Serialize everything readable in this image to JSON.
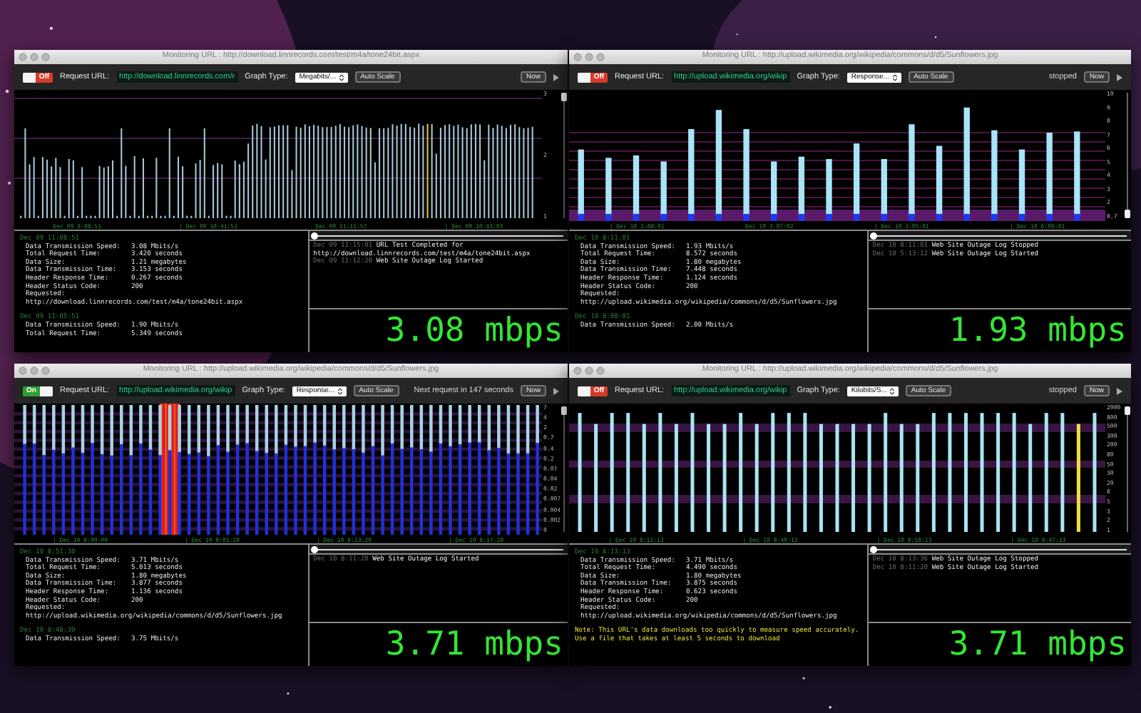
{
  "windows": [
    {
      "title": "Monitoring URL : http://download.linnrecords.com/test/m4a/tone24bit.aspx",
      "toggle": {
        "label": "Off",
        "on": false
      },
      "url_label": "Request URL:",
      "url": "http://download.linnrecords.com/r",
      "graph_type_label": "Graph Type:",
      "graph_type": "Megabits/...",
      "auto_scale": "Auto Scale",
      "now": "Now",
      "graph": {
        "kind": "thin",
        "y_labels": [
          "3",
          "2",
          "1"
        ],
        "time_labels": [
          "Dec 09 8:08:51",
          "| Dec 09 10:41:51",
          "Dec 09 11:15:57",
          "| Dec 09 10:43:03"
        ]
      },
      "timeline": {
        "level": 0
      },
      "results": [
        {
          "time": "Dec 09 11:08:51",
          "fields": [
            {
              "label": "Data Transmission Speed:",
              "value": "3.08 Mbits/s"
            },
            {
              "label": "Total Request Time:",
              "value": "3.420 seconds"
            },
            {
              "label": "Data Size:",
              "value": "1.21 megabytes"
            },
            {
              "label": "Data Transmission Time:",
              "value": "3.153 seconds"
            },
            {
              "label": "Header Response Time:",
              "value": "0.267 seconds"
            },
            {
              "label": "Header Status Code:",
              "value": "200"
            }
          ],
          "requested_label": "Requested:",
          "requested": "http://download.linnrecords.com/test/m4a/tone24bit.aspx"
        },
        {
          "time": "Dec 09 11:05:51",
          "fields": [
            {
              "label": "Data Transmission Speed:",
              "value": "1.90 Mbits/s"
            },
            {
              "label": "Total Request Time:",
              "value": "5.349 seconds"
            }
          ]
        }
      ],
      "events": [
        {
          "time": "Dec 09 11:15:01",
          "text": "URL Test Completed for http://download.linnrecords.com/test/m4a/tone24bit.aspx"
        },
        {
          "time": "Dec 09 11:12:20",
          "text": "Web Site Outage Log Started"
        }
      ],
      "speed": "3.08 mbps"
    },
    {
      "title": "Monitoring URL : http://upload.wikimedia.org/wikipedia/commons/d/d5/Sunflowers.jpg",
      "toggle": {
        "label": "Off",
        "on": false
      },
      "url_label": "Request URL:",
      "url": "http://upload.wikimedia.org/wikip",
      "graph_type_label": "Graph Type:",
      "graph_type": "Response...",
      "auto_scale": "Auto Scale",
      "status": "stopped",
      "now": "Now",
      "graph": {
        "kind": "wide",
        "y_labels": [
          "10",
          "9",
          "8",
          "7",
          "6",
          "5",
          "4",
          "3",
          "2",
          "0.7"
        ],
        "time_labels": [
          "| Dec 10 1:08:01",
          "Dec 10 3:07:02",
          "| Dec 10 3:05:01",
          "| Dec 10 6:00:01"
        ]
      },
      "timeline": {
        "level": 0
      },
      "results": [
        {
          "time": "Dec 10 8:11:01",
          "fields": [
            {
              "label": "Data Transmission Speed:",
              "value": "1.93 Mbits/s"
            },
            {
              "label": "Total Request Time:",
              "value": "8.572 seconds"
            },
            {
              "label": "Data Size:",
              "value": "1.80 megabytes"
            },
            {
              "label": "Data Transmission Time:",
              "value": "7.448 seconds"
            },
            {
              "label": "Header Response Time:",
              "value": "1.124 seconds"
            },
            {
              "label": "Header Status Code:",
              "value": "200"
            }
          ],
          "requested_label": "Requested:",
          "requested": "http://upload.wikimedia.org/wikipedia/commons/d/d5/Sunflowers.jpg"
        },
        {
          "time": "Dec 10 8:08:01",
          "fields": [
            {
              "label": "Data Transmission Speed:",
              "value": "2.00 Mbits/s"
            }
          ]
        }
      ],
      "events": [
        {
          "time": "Dec 10 8:11:01",
          "text": "Web Site Outage Log Stopped"
        },
        {
          "time": "Dec 10 5:13:12",
          "text": "Web Site Outage Log Started"
        }
      ],
      "speed": "1.93 mbps"
    },
    {
      "title": "Monitoring URL : http://upload.wikimedia.org/wikipedia/commons/d/d5/Sunflowers.jpg",
      "toggle": {
        "label": "On",
        "on": true
      },
      "url_label": "Request URL:",
      "url": "http://upload.wikimedia.org/wikip",
      "graph_type_label": "Graph Type:",
      "graph_type": "Response...",
      "auto_scale": "Auto Scale",
      "status": "Next request in 147 seconds",
      "now": "Now",
      "graph": {
        "kind": "dense",
        "y_labels": [
          "7",
          "4",
          "2",
          "0.7",
          "0.4",
          "0.2",
          "0.07",
          "0.04",
          "0.02",
          "0.007",
          "0.004",
          "0.002",
          "0"
        ],
        "time_labels": [
          "| Dec 10 8:00:00",
          "| Dec 10 8:01:20",
          "| Dec 10 8:13:20",
          "| Dec 10 8:17:20"
        ]
      },
      "timeline": {
        "level": 0
      },
      "results": [
        {
          "time": "Dec 10 8:51:30",
          "fields": [
            {
              "label": "Data Transmission Speed:",
              "value": "3.71 Mbits/s"
            },
            {
              "label": "Total Request Time:",
              "value": "5.013 seconds"
            },
            {
              "label": "Data Size:",
              "value": "1.80 megabytes"
            },
            {
              "label": "Data Transmission Time:",
              "value": "3.877 seconds"
            },
            {
              "label": "Header Response Time:",
              "value": "1.136 seconds"
            },
            {
              "label": "Header Status Code:",
              "value": "200"
            }
          ],
          "requested_label": "Requested:",
          "requested": "http://upload.wikimedia.org/wikipedia/commons/d/d5/Sunflowers.jpg"
        },
        {
          "time": "Dec 10 8:48:30",
          "fields": [
            {
              "label": "Data Transmission Speed:",
              "value": "3.75 Mbits/s"
            }
          ]
        }
      ],
      "events": [
        {
          "time": "Dec 10 8:11:20",
          "text": "Web Site Outage Log Started"
        }
      ],
      "speed": "3.71 mbps"
    },
    {
      "title": "Monitoring URL : http://upload.wikimedia.org/wikipedia/commons/d/d5/Sunflowers.jpg",
      "toggle": {
        "label": "Off",
        "on": false
      },
      "url_label": "Request URL:",
      "url": "http://upload.wikimedia.org/wikip",
      "graph_type_label": "Graph Type:",
      "graph_type": "Kilobits/S...",
      "auto_scale": "Auto Scale",
      "status": "stopped",
      "now": "Now",
      "graph": {
        "kind": "sparse",
        "y_labels": [
          "2000",
          "800",
          "500",
          "300",
          "200",
          "80",
          "50",
          "30",
          "20",
          "8",
          "5",
          "3",
          "2",
          "1"
        ],
        "time_labels": [
          "| Dec 10 8:12:13",
          "| Dec 10 8:40:13",
          "| Dec 10 8:58:13",
          "| Dec 10 8:47:13"
        ]
      },
      "timeline": {
        "level": 0
      },
      "results": [
        {
          "time": "Dec 10 8:13:13",
          "fields": [
            {
              "label": "Data Transmission Speed:",
              "value": "3.71 Mbits/s"
            },
            {
              "label": "Total Request Time:",
              "value": "4.490 seconds"
            },
            {
              "label": "Data Size:",
              "value": "1.80 megabytes"
            },
            {
              "label": "Data Transmission Time:",
              "value": "3.875 seconds"
            },
            {
              "label": "Header Response Time:",
              "value": "0.623 seconds"
            },
            {
              "label": "Header Status Code:",
              "value": "200"
            }
          ],
          "requested_label": "Requested:",
          "requested": "http://upload.wikimedia.org/wikipedia/commons/d/d5/Sunflowers.jpg"
        }
      ],
      "note": "Note: This URL's data downloads too quickly to measure speed accurately.  Use a file that takes at least 5 seconds to download",
      "events": [
        {
          "time": "Dec 10 8:13:36",
          "text": "Web Site Outage Log Stopped"
        },
        {
          "time": "Dec 10 8:11:20",
          "text": "Web Site Outage Log Started"
        }
      ],
      "speed": "3.71 mbps"
    }
  ]
}
